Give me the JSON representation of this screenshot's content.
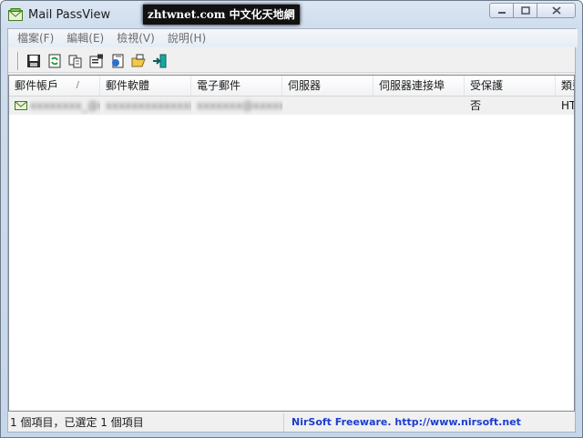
{
  "window": {
    "title": "Mail PassView"
  },
  "watermark": {
    "text": "zhtwnet.com 中文化天地網"
  },
  "caption_buttons": {
    "minimize": "minimize",
    "maximize": "maximize",
    "close": "close"
  },
  "menu": {
    "items": [
      {
        "label": "檔案(F)"
      },
      {
        "label": "編輯(E)"
      },
      {
        "label": "檢視(V)"
      },
      {
        "label": "說明(H)"
      }
    ]
  },
  "toolbar": {
    "icons": [
      "save-icon",
      "refresh-icon",
      "copy-icon",
      "properties-icon",
      "report-icon",
      "open-folder-icon",
      "exit-icon"
    ]
  },
  "table": {
    "columns": [
      "郵件帳戶",
      "郵件軟體",
      "電子郵件",
      "伺服器",
      "伺服器連接埠",
      "受保護",
      "類型"
    ],
    "sort_indicator": "/",
    "rows": [
      {
        "account": "xxxxxxxx_@xx",
        "app": "xxxxxxxxxxxxxxx",
        "email": "xxxxxxx@xxxxx",
        "server": "",
        "port": "",
        "protected": "否",
        "type": "HTTP"
      }
    ]
  },
  "status": {
    "items_text": "1 個項目，已選定 1 個項目",
    "link_text": "NirSoft Freeware.  http://www.nirsoft.net"
  },
  "colors": {
    "link": "#1b3dd1",
    "selected_row": "#f0f0f0"
  }
}
